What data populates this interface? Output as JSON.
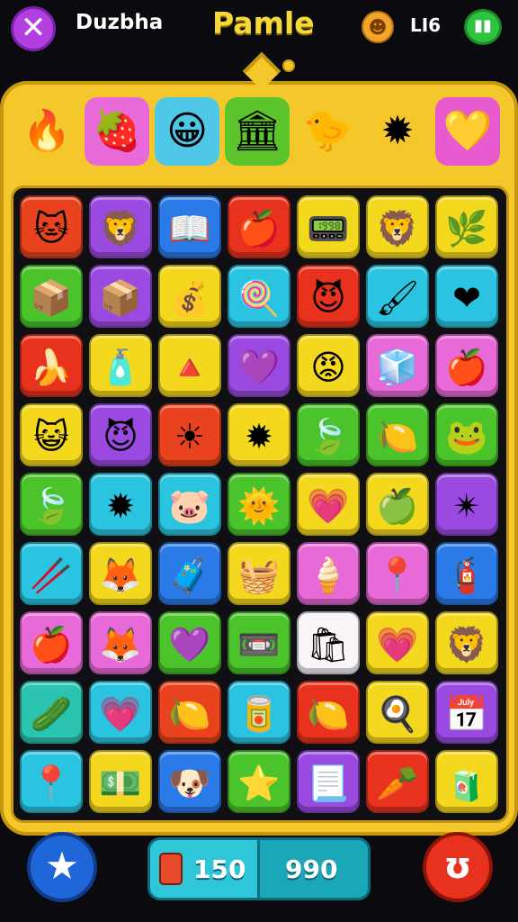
{
  "header": {
    "close_icon": "✕",
    "player_name": "Duzbha",
    "title": "Pamle",
    "coin_icon": "☻",
    "score": "LI6",
    "menu_icon": "▮▮"
  },
  "heroes": [
    {
      "icon": "🔥",
      "bg": "#f4c82a"
    },
    {
      "icon": "🍓",
      "bg": "#e86ad8"
    },
    {
      "icon": "😀",
      "bg": "#4fc8e8"
    },
    {
      "icon": "🏛",
      "bg": "#5ac42a"
    },
    {
      "icon": "🐤",
      "bg": "#f4c82a"
    },
    {
      "icon": "✹",
      "bg": "#f4c82a"
    },
    {
      "icon": "💛",
      "bg": "#e85ad0"
    }
  ],
  "board": {
    "rows": [
      [
        {
          "icon": "🐱",
          "bg": "#e8421e"
        },
        {
          "icon": "🦁",
          "bg": "#9a4ae0"
        },
        {
          "icon": "📖",
          "bg": "#2a7ae8"
        },
        {
          "icon": "🍎",
          "bg": "#e8321e"
        },
        {
          "icon": "📟",
          "bg": "#f4d81e"
        },
        {
          "icon": "🦁",
          "bg": "#f4d81e"
        },
        {
          "icon": "🌿",
          "bg": "#f4d81e"
        }
      ],
      [
        {
          "icon": "📦",
          "bg": "#4ac42a"
        },
        {
          "icon": "📦",
          "bg": "#9a4ae0"
        },
        {
          "icon": "💰",
          "bg": "#f4d81e"
        },
        {
          "icon": "🍭",
          "bg": "#2ac4e0"
        },
        {
          "icon": "😈",
          "bg": "#e8321e"
        },
        {
          "icon": "🖌",
          "bg": "#2ac4e0"
        },
        {
          "icon": "❤",
          "bg": "#2ac4e0"
        }
      ],
      [
        {
          "icon": "🍌",
          "bg": "#e8321e"
        },
        {
          "icon": "🧴",
          "bg": "#f4d81e"
        },
        {
          "icon": "🔺",
          "bg": "#f4d81e"
        },
        {
          "icon": "💜",
          "bg": "#9a4ae0"
        },
        {
          "icon": "😡",
          "bg": "#f4d81e"
        },
        {
          "icon": "🧊",
          "bg": "#e86ad8"
        },
        {
          "icon": "🍎",
          "bg": "#e86ad8"
        }
      ],
      [
        {
          "icon": "😺",
          "bg": "#f4d81e"
        },
        {
          "icon": "😈",
          "bg": "#9a4ae0"
        },
        {
          "icon": "☀",
          "bg": "#e8421e"
        },
        {
          "icon": "✹",
          "bg": "#f4d81e"
        },
        {
          "icon": "🍃",
          "bg": "#4ac42a"
        },
        {
          "icon": "🍋",
          "bg": "#4ac42a"
        },
        {
          "icon": "🐸",
          "bg": "#4ac42a"
        }
      ],
      [
        {
          "icon": "🍃",
          "bg": "#4ac42a"
        },
        {
          "icon": "✹",
          "bg": "#2ac4e0"
        },
        {
          "icon": "🐷",
          "bg": "#2ac4e0"
        },
        {
          "icon": "🌞",
          "bg": "#4ac42a"
        },
        {
          "icon": "💗",
          "bg": "#f4d81e"
        },
        {
          "icon": "🍏",
          "bg": "#f4d81e"
        },
        {
          "icon": "✴",
          "bg": "#9a4ae0"
        }
      ],
      [
        {
          "icon": "🥢",
          "bg": "#2ac4e0"
        },
        {
          "icon": "🦊",
          "bg": "#f4d81e"
        },
        {
          "icon": "🧳",
          "bg": "#2a7ae8"
        },
        {
          "icon": "🧺",
          "bg": "#f4d81e"
        },
        {
          "icon": "🍦",
          "bg": "#e86ad8"
        },
        {
          "icon": "📍",
          "bg": "#e86ad8"
        },
        {
          "icon": "🧯",
          "bg": "#2a7ae8"
        }
      ],
      [
        {
          "icon": "🍎",
          "bg": "#e86ad8"
        },
        {
          "icon": "🦊",
          "bg": "#e86ad8"
        },
        {
          "icon": "💜",
          "bg": "#4ac42a"
        },
        {
          "icon": "📼",
          "bg": "#4ac42a"
        },
        {
          "icon": "🛍",
          "bg": "#f8f4f8"
        },
        {
          "icon": "💗",
          "bg": "#f4d81e"
        },
        {
          "icon": "🦁",
          "bg": "#f4d81e"
        }
      ],
      [
        {
          "icon": "🥒",
          "bg": "#2ac4b0"
        },
        {
          "icon": "💗",
          "bg": "#2ac4e0"
        },
        {
          "icon": "🍋",
          "bg": "#e8421e"
        },
        {
          "icon": "🥫",
          "bg": "#2ac4e0"
        },
        {
          "icon": "🍋",
          "bg": "#e8321e"
        },
        {
          "icon": "🍳",
          "bg": "#f4d81e"
        },
        {
          "icon": "📅",
          "bg": "#9a4ae0"
        }
      ],
      [
        {
          "icon": "📍",
          "bg": "#2ac4e0"
        },
        {
          "icon": "💵",
          "bg": "#f4d81e"
        },
        {
          "icon": "🐶",
          "bg": "#2a7ae8"
        },
        {
          "icon": "⭐",
          "bg": "#4ac42a"
        },
        {
          "icon": "📃",
          "bg": "#9a4ae0"
        },
        {
          "icon": "🥕",
          "bg": "#e8321e"
        },
        {
          "icon": "🧃",
          "bg": "#f4d81e"
        }
      ]
    ]
  },
  "footer": {
    "star_icon": "★",
    "counter_left": "150",
    "counter_right": "990",
    "action_icon": "ʊ"
  }
}
